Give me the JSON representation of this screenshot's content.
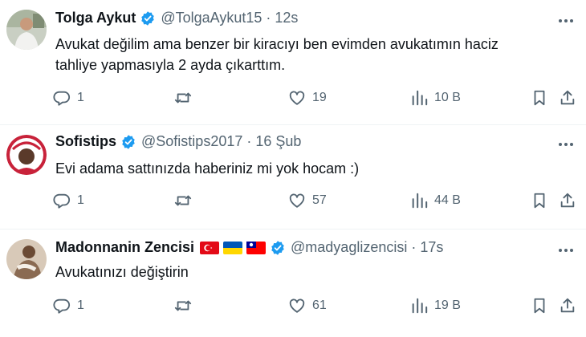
{
  "tweets": [
    {
      "name": "Tolga Aykut",
      "handle": "@TolgaAykut15",
      "separator": "·",
      "time": "12s",
      "text": "Avukat değilim ama benzer bir kiracıyı ben evimden avukatımın haciz\ntahliye yapmasıyla 2 ayda çıkarttım.",
      "replies": "1",
      "retweets": "",
      "likes": "19",
      "views": "10 B"
    },
    {
      "name": "Sofistips",
      "handle": "@Sofistips2017",
      "separator": "·",
      "time": "16 Şub",
      "text": "Evi adama sattınızda haberiniz mi yok hocam :)",
      "replies": "1",
      "retweets": "",
      "likes": "57",
      "views": "44 B"
    },
    {
      "name": "Madonnanin Zencisi",
      "handle": "@madyaglizencisi",
      "separator": "·",
      "time": "17s",
      "text": "Avukatınızı değiştirin",
      "replies": "1",
      "retweets": "",
      "likes": "61",
      "views": "19 B",
      "name_flags": [
        "turkey-flag-icon",
        "ukraine-flag-icon",
        "taiwan-flag-icon"
      ]
    }
  ],
  "colors": {
    "verified": "#1d9bf0",
    "secondary_text": "#536471",
    "primary_text": "#0f1419",
    "divider": "#eff3f4"
  },
  "icons": [
    "reply-icon",
    "retweet-icon",
    "like-icon",
    "views-icon",
    "bookmark-icon",
    "share-icon",
    "more-icon",
    "verified-badge-icon"
  ]
}
